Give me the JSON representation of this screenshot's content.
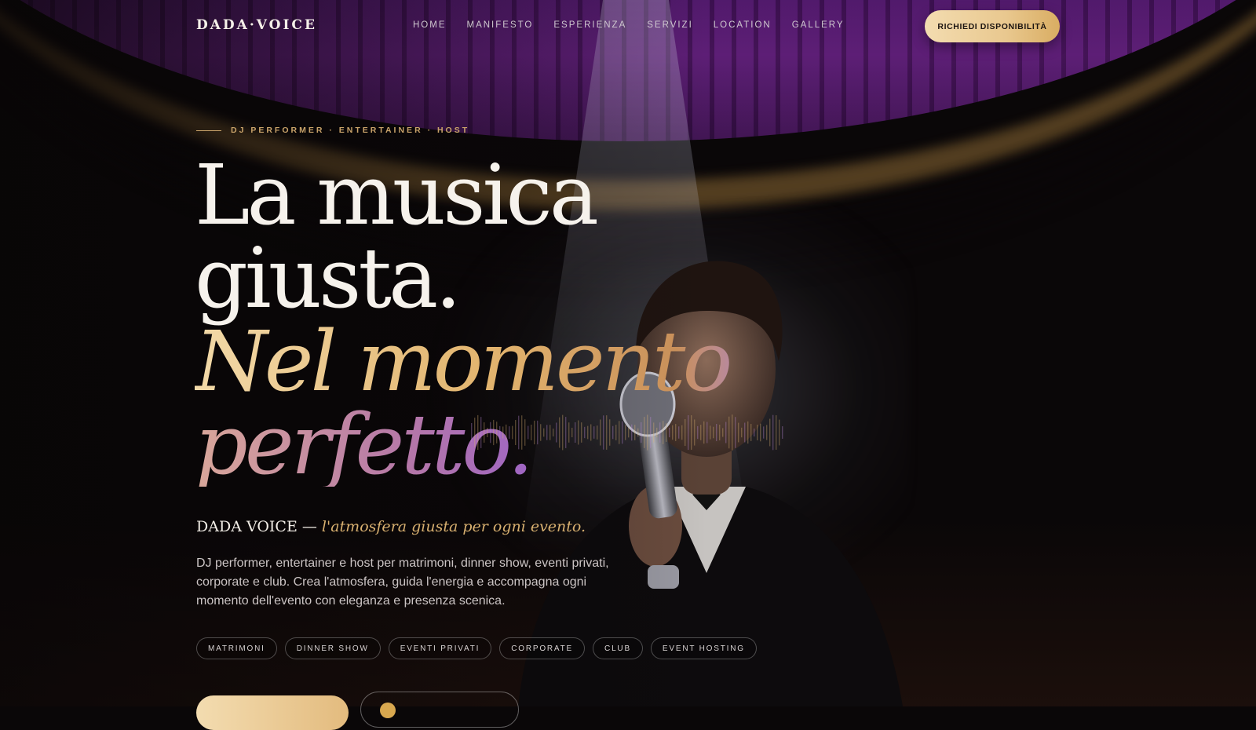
{
  "nav": {
    "logo": "DADA·VOICE",
    "items": [
      {
        "label": "HOME"
      },
      {
        "label": "MANIFESTO"
      },
      {
        "label": "ESPERIENZA"
      },
      {
        "label": "SERVIZI"
      },
      {
        "label": "LOCATION"
      },
      {
        "label": "GALLERY"
      }
    ],
    "cta": "RICHIEDI DISPONIBILITÀ"
  },
  "hero": {
    "eyebrow": "DJ PERFORMER · ENTERTAINER · HOST",
    "headline": {
      "line1": "La musica",
      "line2": "giusta.",
      "line3": "Nel momento",
      "line4": "perfetto."
    },
    "tagline_brand": "DADA VOICE —",
    "tagline_italic": "l'atmosfera giusta per ogni evento.",
    "description": "DJ performer, entertainer e host per matrimoni, dinner show, eventi privati, corporate e club. Crea l'atmosfera, guida l'energia e accompagna ogni momento dell'evento con eleganza e presenza scenica.",
    "tags": [
      "MATRIMONI",
      "DINNER SHOW",
      "EVENTI PRIVATI",
      "CORPORATE",
      "CLUB",
      "EVENT HOSTING"
    ]
  },
  "colors": {
    "accent_gold": "#e2b46e",
    "accent_purple": "#8e58d8",
    "background": "#0a0708"
  },
  "icons": {
    "secondary_button_icon": "gold-dot-icon"
  }
}
